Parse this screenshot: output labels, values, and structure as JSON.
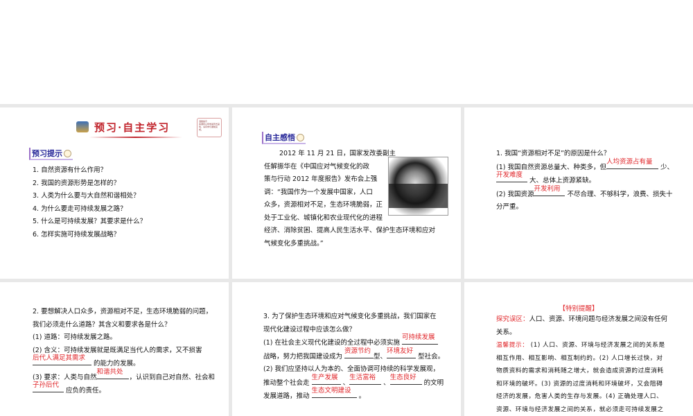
{
  "slide1": {
    "banner_title": "预习·自主学习",
    "note_title": "温馨提示",
    "note_text": "本课时以导学案形式呈现，请同学们课前完成。",
    "tag": "预习提示",
    "questions": [
      "1. 自然资源有什么作用？",
      "2. 我国的资源形势是怎样的？",
      "3. 人类为什么要与大自然和谐相处？",
      "4. 为什么要走可持续发展之路？",
      "5. 什么是可持续发展？其要求是什么？",
      "6. 怎样实施可持续发展战略？"
    ]
  },
  "slide2": {
    "tag": "自主感悟",
    "lines": [
      "2012 年 11 月 21 日，国家发改委副主",
      "任解振华在《中国应对气候变化的政",
      "策与行动 2012 年度报告》发布会上强",
      "调：“我国作为一个发展中国家，人口",
      "众多，资源相对不足，生态环境脆弱，正",
      "处于工业化、城镇化和农业现代化的进程",
      "经济、消除贫困、提高人民生活水平、保护生态环境和应对",
      "气候变化多重挑战。”"
    ]
  },
  "slide3": {
    "q": "1. 我国“资源相对不足”的原因是什么？",
    "p1a": "(1) 我国自然资源总量大、种类多，但",
    "ans1": "人均资源占有量",
    "p1b": "少、",
    "ans2": "开发难度",
    "p1c": "大、总体上资源紧缺。",
    "p2a": "(2) 我国资源",
    "ans3": "开发利用",
    "p2b": "不尽合理、不够科学，浪费、损失十",
    "p2c": "分严重。"
  },
  "slide4": {
    "q1": "2. 要想解决人口众多，资源相对不足，生态环境脆弱的问题，",
    "q2": "我们必须走什么道路？其含义和要求各是什么？",
    "a1": "(1) 道路：可持续发展之路。",
    "a2": "(2) 含义：可持续发展就是既满足当代人的需求，又不损害",
    "ans1": "后代人满足其需求",
    "a2b": "的能力的发展。",
    "a3": "(3) 要求：人类与自然",
    "ans2": "和谐共处",
    "a3b": "，认识到自己对自然、社会和",
    "ans3": "子孙后代",
    "a3c": "应负的责任。"
  },
  "slide5": {
    "q1": "3. 为了保护生态环境和应对气候变化多重挑战，我们国家在",
    "q2": "现代化建设过程中应该怎么做？",
    "a1": "(1) 在社会主义现代化建设的全过程中必须实施",
    "ans1": "可持续发展",
    "a1b": "战略，努力把我国建设成为",
    "ans2": "资源节约",
    "a1c": "型、",
    "ans3": "环境友好",
    "a1d": "型社会。",
    "a2": "(2) 我们应坚持以人为本的、全面协调可持续的科学发展观，",
    "a2b": "推动整个社会走",
    "ans4": "生产发展",
    "sep": "、",
    "ans5": "生活富裕",
    "ans6": "生态良好",
    "a2c": "的文明",
    "a2d": "发展道路，推动",
    "ans7": "生态文明建设",
    "end": "。"
  },
  "slide6": {
    "heading": "【特别提醒】",
    "label1": "探究误区：",
    "text1a": "人口、资源、环境问题与经济发展之间没有任何",
    "text1b": "关系。",
    "label2": "温馨提示：",
    "lines": [
      "(1) 人口、资源、环境与经济发展之间的关系是",
      "相互作用、相互影响、相互制约的。(2) 人口增长过快，对",
      "物质资料的需求和消耗随之增大，就会造成资源的过度消耗",
      "和环境的破坏。(3) 资源的过度消耗和环境破坏，又会阻碍",
      "经济的发展，危害人类的生存与发展。(4) 正确处理人口、",
      "资源、环境与经济发展之间的关系，就必须走可持续发展之"
    ]
  }
}
